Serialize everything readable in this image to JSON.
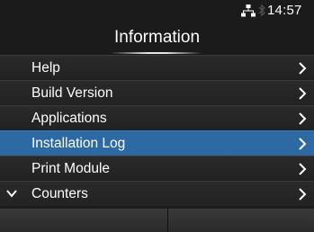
{
  "status_bar": {
    "time": "14:57",
    "network_icon": "network-icon",
    "bluetooth_icon": "bluetooth-icon"
  },
  "header": {
    "title": "Information"
  },
  "menu": {
    "items": [
      {
        "label": "Help",
        "selected": false
      },
      {
        "label": "Build Version",
        "selected": false
      },
      {
        "label": "Applications",
        "selected": false
      },
      {
        "label": "Installation Log",
        "selected": true
      },
      {
        "label": "Print Module",
        "selected": false
      },
      {
        "label": "Counters",
        "selected": false
      }
    ]
  },
  "colors": {
    "selected": "#2d6aa4",
    "background": "#1b1b1b"
  }
}
